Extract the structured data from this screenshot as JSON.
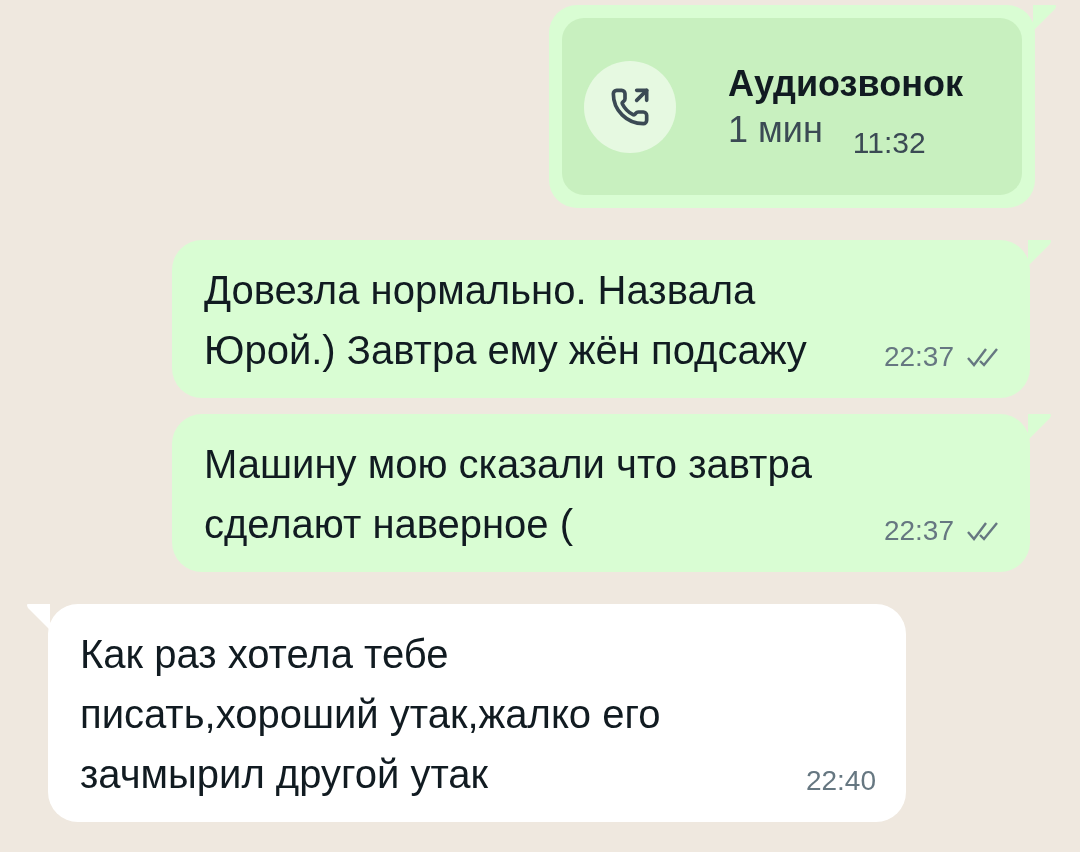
{
  "messages": [
    {
      "kind": "call",
      "outgoing": true,
      "title": "Аудиозвонок",
      "duration": "1 мин",
      "time": "11:32"
    },
    {
      "kind": "text",
      "outgoing": true,
      "text": "Довезла нормально. Назвала Юрой.) Завтра ему жён подсажу",
      "time": "22:37",
      "read": false
    },
    {
      "kind": "text",
      "outgoing": true,
      "text": "Машину мою сказали что завтра сделают наверное (",
      "time": "22:37",
      "read": false
    },
    {
      "kind": "text",
      "outgoing": false,
      "text": "Как раз хотела тебе писать,хороший утак,жалко его зачмырил другой утак",
      "time": "22:40"
    }
  ]
}
